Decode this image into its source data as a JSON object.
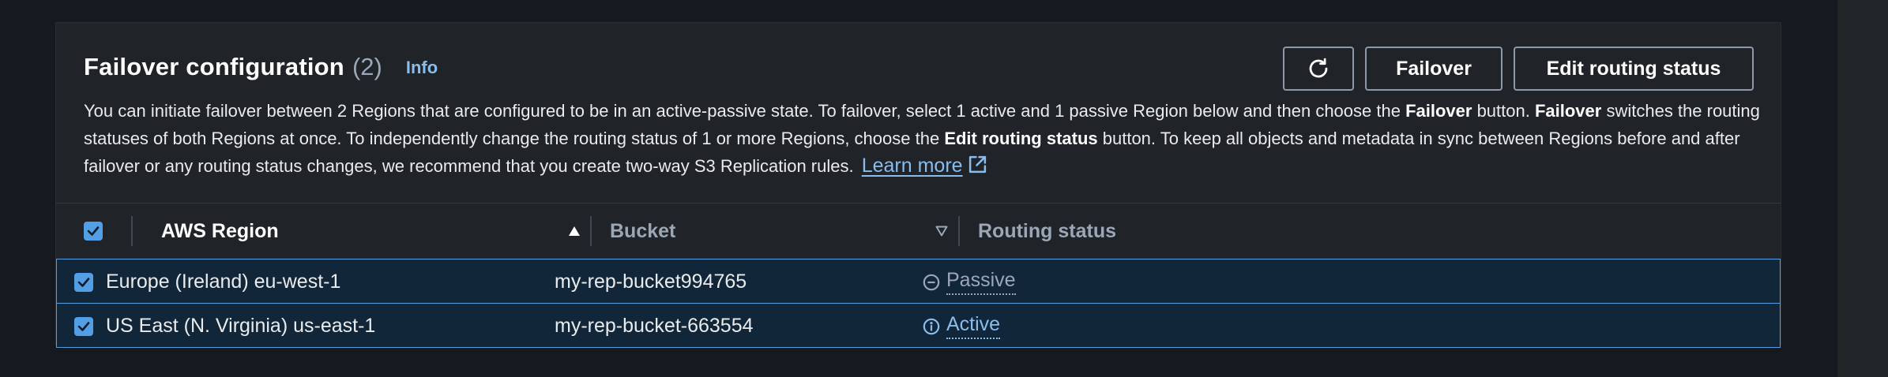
{
  "panel": {
    "title": "Failover configuration",
    "count": "(2)",
    "info_label": "Info",
    "description_parts": {
      "p1": "You can initiate failover between 2 Regions that are configured to be in an active-passive state. To failover, select 1 active and 1 passive Region below and then choose the ",
      "b1": "Failover",
      "p2": " button. ",
      "b2": "Failover",
      "p3": " switches the routing statuses of both Regions at once. To independently change the routing status of 1 or more Regions, choose the ",
      "b3": "Edit routing status",
      "p4": " button. To keep all objects and metadata in sync between Regions before and after failover or any routing status changes, we recommend that you create two-way S3 Replication rules. "
    },
    "learn_more_label": "Learn more",
    "buttons": {
      "refresh_icon": "refresh-icon",
      "failover_label": "Failover",
      "edit_routing_label": "Edit routing status"
    }
  },
  "table": {
    "columns": {
      "region": "AWS Region",
      "bucket": "Bucket",
      "routing": "Routing status"
    },
    "sort": {
      "region": "ascending",
      "bucket": "unsorted"
    },
    "rows": [
      {
        "region": "Europe (Ireland) eu-west-1",
        "bucket": "my-rep-bucket994765",
        "status": "Passive",
        "status_icon": "minus-circle-icon",
        "selected": true
      },
      {
        "region": "US East (N. Virginia) us-east-1",
        "bucket": "my-rep-bucket-663554",
        "status": "Active",
        "status_icon": "info-circle-icon",
        "selected": true
      }
    ]
  },
  "colors": {
    "accent": "#539fe5",
    "link": "#89bdee",
    "passive": "#9ba7b6",
    "active": "#89bdee"
  }
}
